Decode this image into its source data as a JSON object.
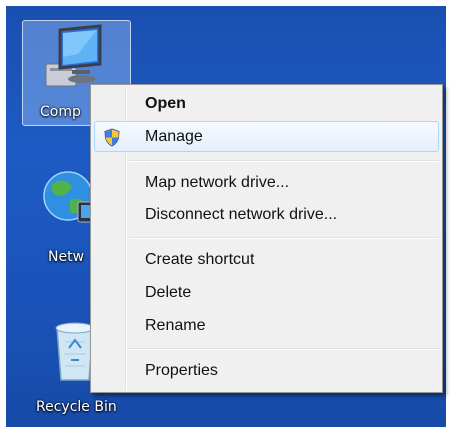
{
  "desktop": {
    "icons": [
      {
        "label": "Comp",
        "icon": "computer-icon"
      },
      {
        "label": "Netw",
        "icon": "network-globe-icon"
      },
      {
        "label": "Recycle Bin",
        "icon": "recycle-bin-icon"
      }
    ]
  },
  "context_menu": {
    "items": [
      {
        "label": "Open"
      },
      {
        "label": "Manage",
        "icon": "uac-shield-icon"
      },
      {
        "label": "Map network drive..."
      },
      {
        "label": "Disconnect network drive..."
      },
      {
        "label": "Create shortcut"
      },
      {
        "label": "Delete"
      },
      {
        "label": "Rename"
      },
      {
        "label": "Properties"
      }
    ]
  },
  "colors": {
    "desktop_background": "#1d5bc4",
    "menu_background": "#f0f0f0",
    "hover_border": "#a8d8fb"
  }
}
